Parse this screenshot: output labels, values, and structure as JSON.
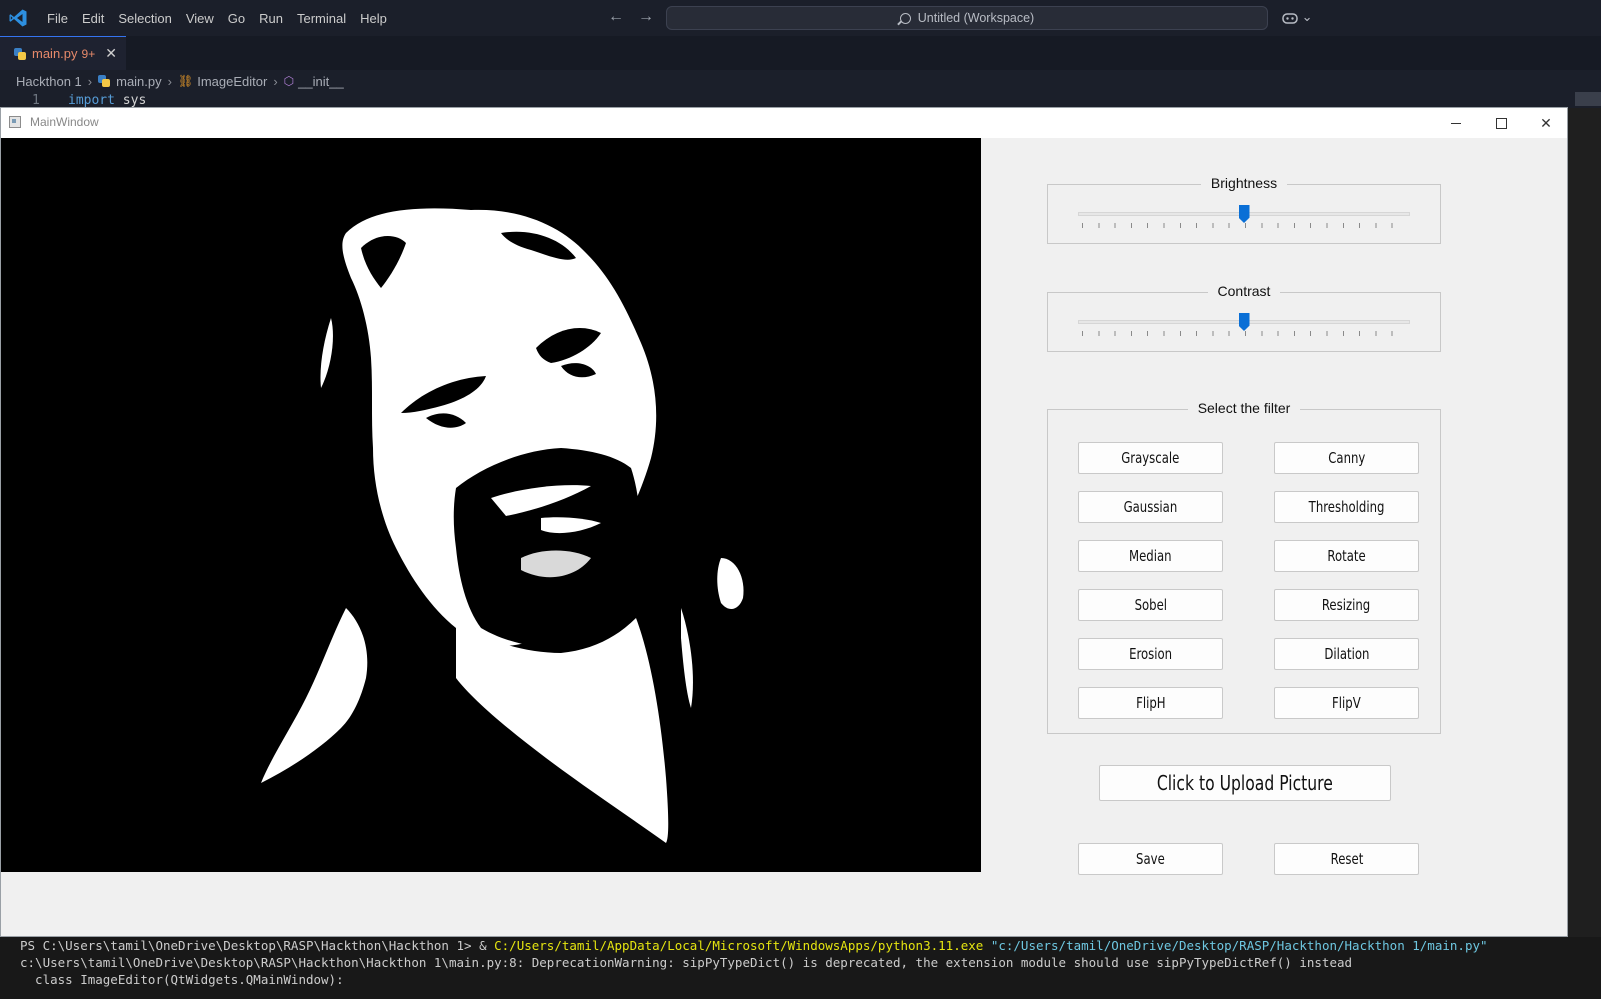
{
  "vscode": {
    "menu": [
      "File",
      "Edit",
      "Selection",
      "View",
      "Go",
      "Run",
      "Terminal",
      "Help"
    ],
    "nav_back": "←",
    "nav_forward": "→",
    "search_text": "Untitled (Workspace)",
    "copilot_glyph": "⌄",
    "tab": {
      "name": "main.py",
      "modified": "9+",
      "close": "✕"
    },
    "breadcrumb": {
      "folder": "Hackthon 1",
      "file": "main.py",
      "class": "ImageEditor",
      "method": "__init__"
    },
    "code": {
      "line_no": "1",
      "keyword": "import",
      "module": "sys"
    }
  },
  "qt": {
    "title": "MainWindow",
    "brightness": {
      "label": "Brightness",
      "value_fraction": 0.5
    },
    "contrast": {
      "label": "Contrast",
      "value_fraction": 0.5
    },
    "filter_group": "Select the filter",
    "filters": {
      "grayscale": "Grayscale",
      "canny": "Canny",
      "gaussian": "Gaussian",
      "thresholding": "Thresholding",
      "median": "Median",
      "rotate": "Rotate",
      "sobel": "Sobel",
      "resizing": "Resizing",
      "erosion": "Erosion",
      "dilation": "Dilation",
      "fliph": "FlipH",
      "flipv": "FlipV"
    },
    "upload": "Click to Upload Picture",
    "save": "Save",
    "reset": "Reset"
  },
  "terminal": {
    "line1_prompt": "PS C:\\Users\\tamil\\OneDrive\\Desktop\\RASP\\Hackthon\\Hackthon 1> & ",
    "line1_exe": "C:/Users/tamil/AppData/Local/Microsoft/WindowsApps/python3.11.exe",
    "line1_arg": " \"c:/Users/tamil/OneDrive/Desktop/RASP/Hackthon/Hackthon 1/main.py\"",
    "line2": "c:\\Users\\tamil\\OneDrive\\Desktop\\RASP\\Hackthon\\Hackthon 1\\main.py:8: DeprecationWarning: sipPyTypeDict() is deprecated, the extension module should use sipPyTypeDictRef() instead",
    "line3": "  class ImageEditor(QtWidgets.QMainWindow):"
  },
  "colors": {
    "accent": "#0a6fd6",
    "vscode_bg": "#1b1f2a",
    "qt_bg": "#f0f0f0"
  }
}
